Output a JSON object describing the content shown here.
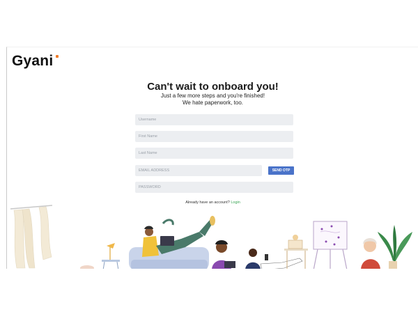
{
  "brand": {
    "name": "Gyani"
  },
  "page": {
    "heading": "Can't wait to onboard you!",
    "subtitle_line1": "Just a few more steps and you're finished!",
    "subtitle_line2": "We hate paperwork, too."
  },
  "form": {
    "username_placeholder": "Username",
    "first_name_placeholder": "First Name",
    "last_name_placeholder": "Last Name",
    "email_placeholder": "EMAIL ADDRESS",
    "password_placeholder": "PASSWORD",
    "send_otp_label": "SEND OTP"
  },
  "login_prompt": {
    "text": "Already have an account?",
    "link": "Login"
  },
  "colors": {
    "accent": "#4a73c9",
    "link": "#3aa655",
    "field_bg": "#eceef1",
    "logo_dot": "#f07d2a"
  }
}
